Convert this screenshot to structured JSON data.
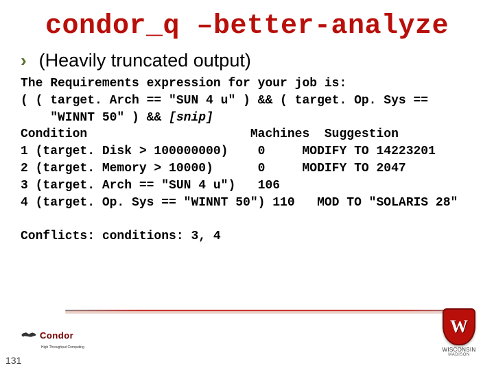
{
  "title": "condor_q –better-analyze",
  "bullet_glyph": "›",
  "bullet_text": "(Heavily truncated output)",
  "code": {
    "l1": "The Requirements expression for your job is:",
    "l2a": "( ( target. Arch == \"SUN 4 u\" ) && ( target. Op. Sys ==",
    "l2b": "    \"WINNT 50\" ) && ",
    "l2c": "[snip]",
    "l3": "Condition                      Machines  Suggestion",
    "l4": "1 (target. Disk > 100000000)    0     MODIFY TO 14223201",
    "l5": "2 (target. Memory > 10000)      0     MODIFY TO 2047",
    "l6": "3 (target. Arch == \"SUN 4 u\")   106",
    "l7": "4 (target. Op. Sys == \"WINNT 50\") 110   MOD TO \"SOLARIS 28\"",
    "blank": "",
    "l8": "Conflicts: conditions: 3, 4"
  },
  "footer": {
    "condor_word": "Condor",
    "condor_tag": "High Throughput Computing",
    "crest_letter": "W",
    "crest_label": "WISCONSIN",
    "crest_sublabel": "MADISON"
  },
  "page_number": "131"
}
